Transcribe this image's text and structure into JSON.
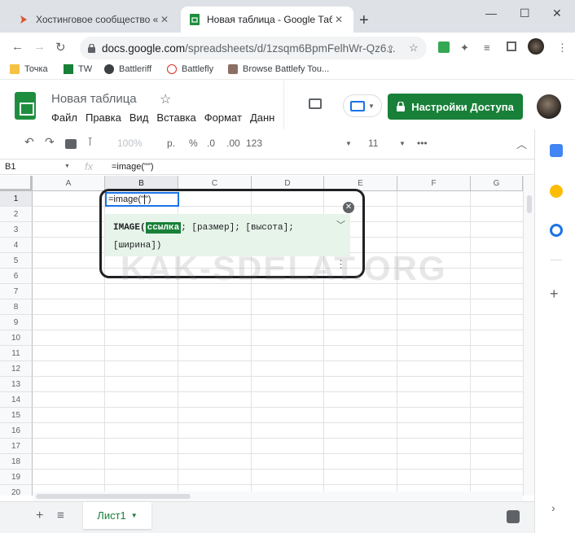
{
  "browser": {
    "tabs": [
      {
        "title": "Хостинговое сообщество «Time",
        "close": "✕",
        "active": false
      },
      {
        "title": "Новая таблица - Google Таблиц",
        "close": "✕",
        "active": true
      }
    ],
    "new_tab": "+",
    "window_controls": {
      "minimize": "—",
      "maximize": "☐",
      "close": "✕"
    },
    "address": {
      "host": "docs.google.com",
      "path": "/spreadsheets/d/1zsqm6BpmFelhWr-Qz6..."
    },
    "bookmarks": [
      "Точка",
      "TW",
      "Battleriff",
      "Battlefly",
      "Browse Battlefy Tou..."
    ]
  },
  "sheets": {
    "doc_title": "Новая таблица",
    "menu": [
      "Файл",
      "Правка",
      "Вид",
      "Вставка",
      "Формат",
      "Данн"
    ],
    "share_label": "Настройки Доступа",
    "toolbar": {
      "zoom": "100%",
      "currency": "р.",
      "percent": "%",
      "dec_less": ".0",
      "dec_more": ".00",
      "more_formats": "123",
      "font_size": "11",
      "more": "•••"
    },
    "namebox": "B1",
    "fx": "fx",
    "formula": "=image(\"\")",
    "columns": [
      "A",
      "B",
      "C",
      "D",
      "E",
      "F",
      "G"
    ],
    "rows": [
      "1",
      "2",
      "3",
      "4",
      "5",
      "6",
      "7",
      "8",
      "9",
      "10",
      "11",
      "12",
      "13",
      "14",
      "15",
      "16",
      "17",
      "18",
      "19",
      "20"
    ],
    "cell_b1": "=image(\"",
    "cell_b1_after": "\")",
    "help": {
      "fn": "IMAGE(",
      "arg1": "ссылка",
      "rest": "; [размер]; [высота];",
      "line2": "[ширина])"
    },
    "sheet_tab": "Лист1",
    "watermark": "KAK-SDELAT.ORG"
  },
  "colors": {
    "accent_green": "#188038",
    "blue": "#1a73e8",
    "help_bg": "#e6f4ea"
  }
}
